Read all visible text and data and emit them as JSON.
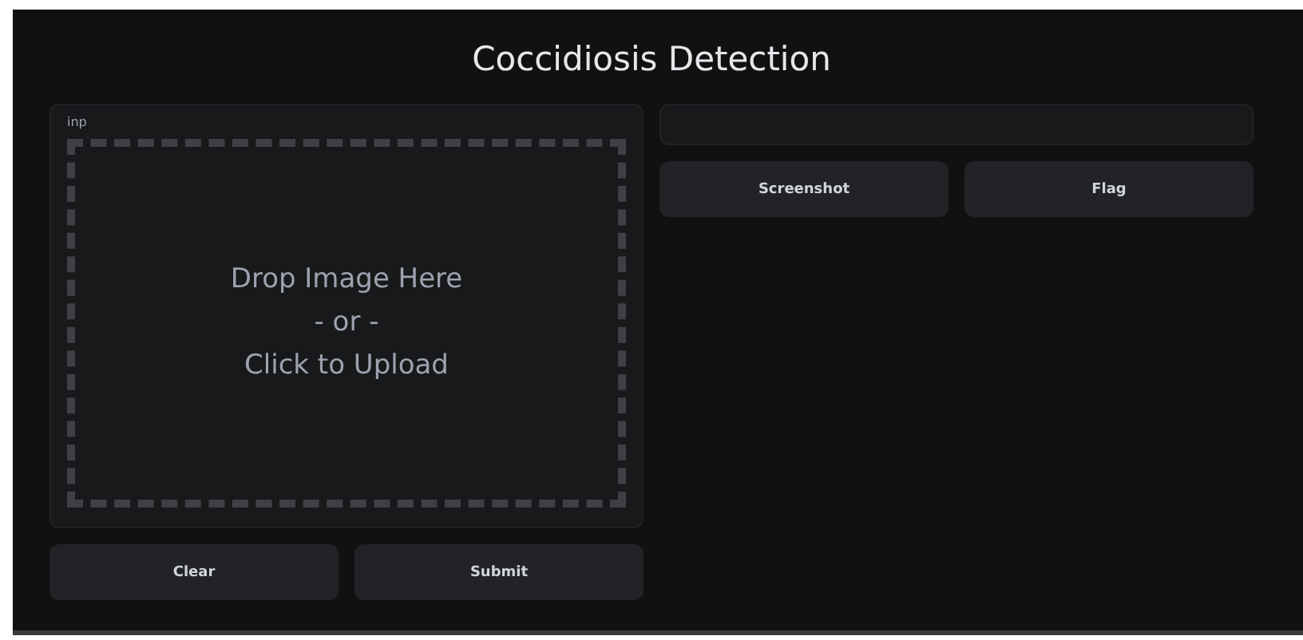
{
  "title": "Coccidiosis Detection",
  "input": {
    "label": "inp",
    "drop_lines": [
      "Drop Image Here",
      "- or -",
      "Click to Upload"
    ]
  },
  "input_buttons": [
    "Clear",
    "Submit"
  ],
  "output_buttons": [
    "Screenshot",
    "Flag"
  ]
}
